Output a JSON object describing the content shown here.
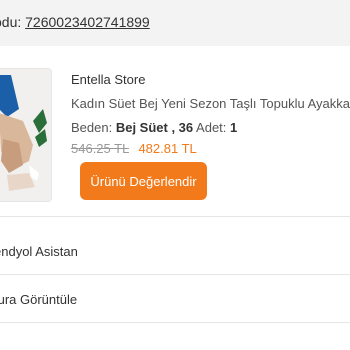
{
  "order": {
    "code_prefix": "odu:",
    "code_value": "7260023402741899"
  },
  "product": {
    "store": "Entella Store",
    "name": "Kadın Süet Bej Yeni Sezon Taşlı Topuklu Ayakka",
    "size_label": "Beden:",
    "size_value": "Bej Süet , 36",
    "qty_label": "Adet:",
    "qty_value": "1",
    "old_price": "546.25 TL",
    "new_price": "482.81 TL",
    "rate_button": "Ürünü Değerlendir"
  },
  "menu": [
    {
      "label": "endyol Asistan"
    },
    {
      "label": "tura Görüntüle"
    }
  ],
  "colors": {
    "accent": "#f27a1a",
    "divider": "#e6e6e6"
  }
}
